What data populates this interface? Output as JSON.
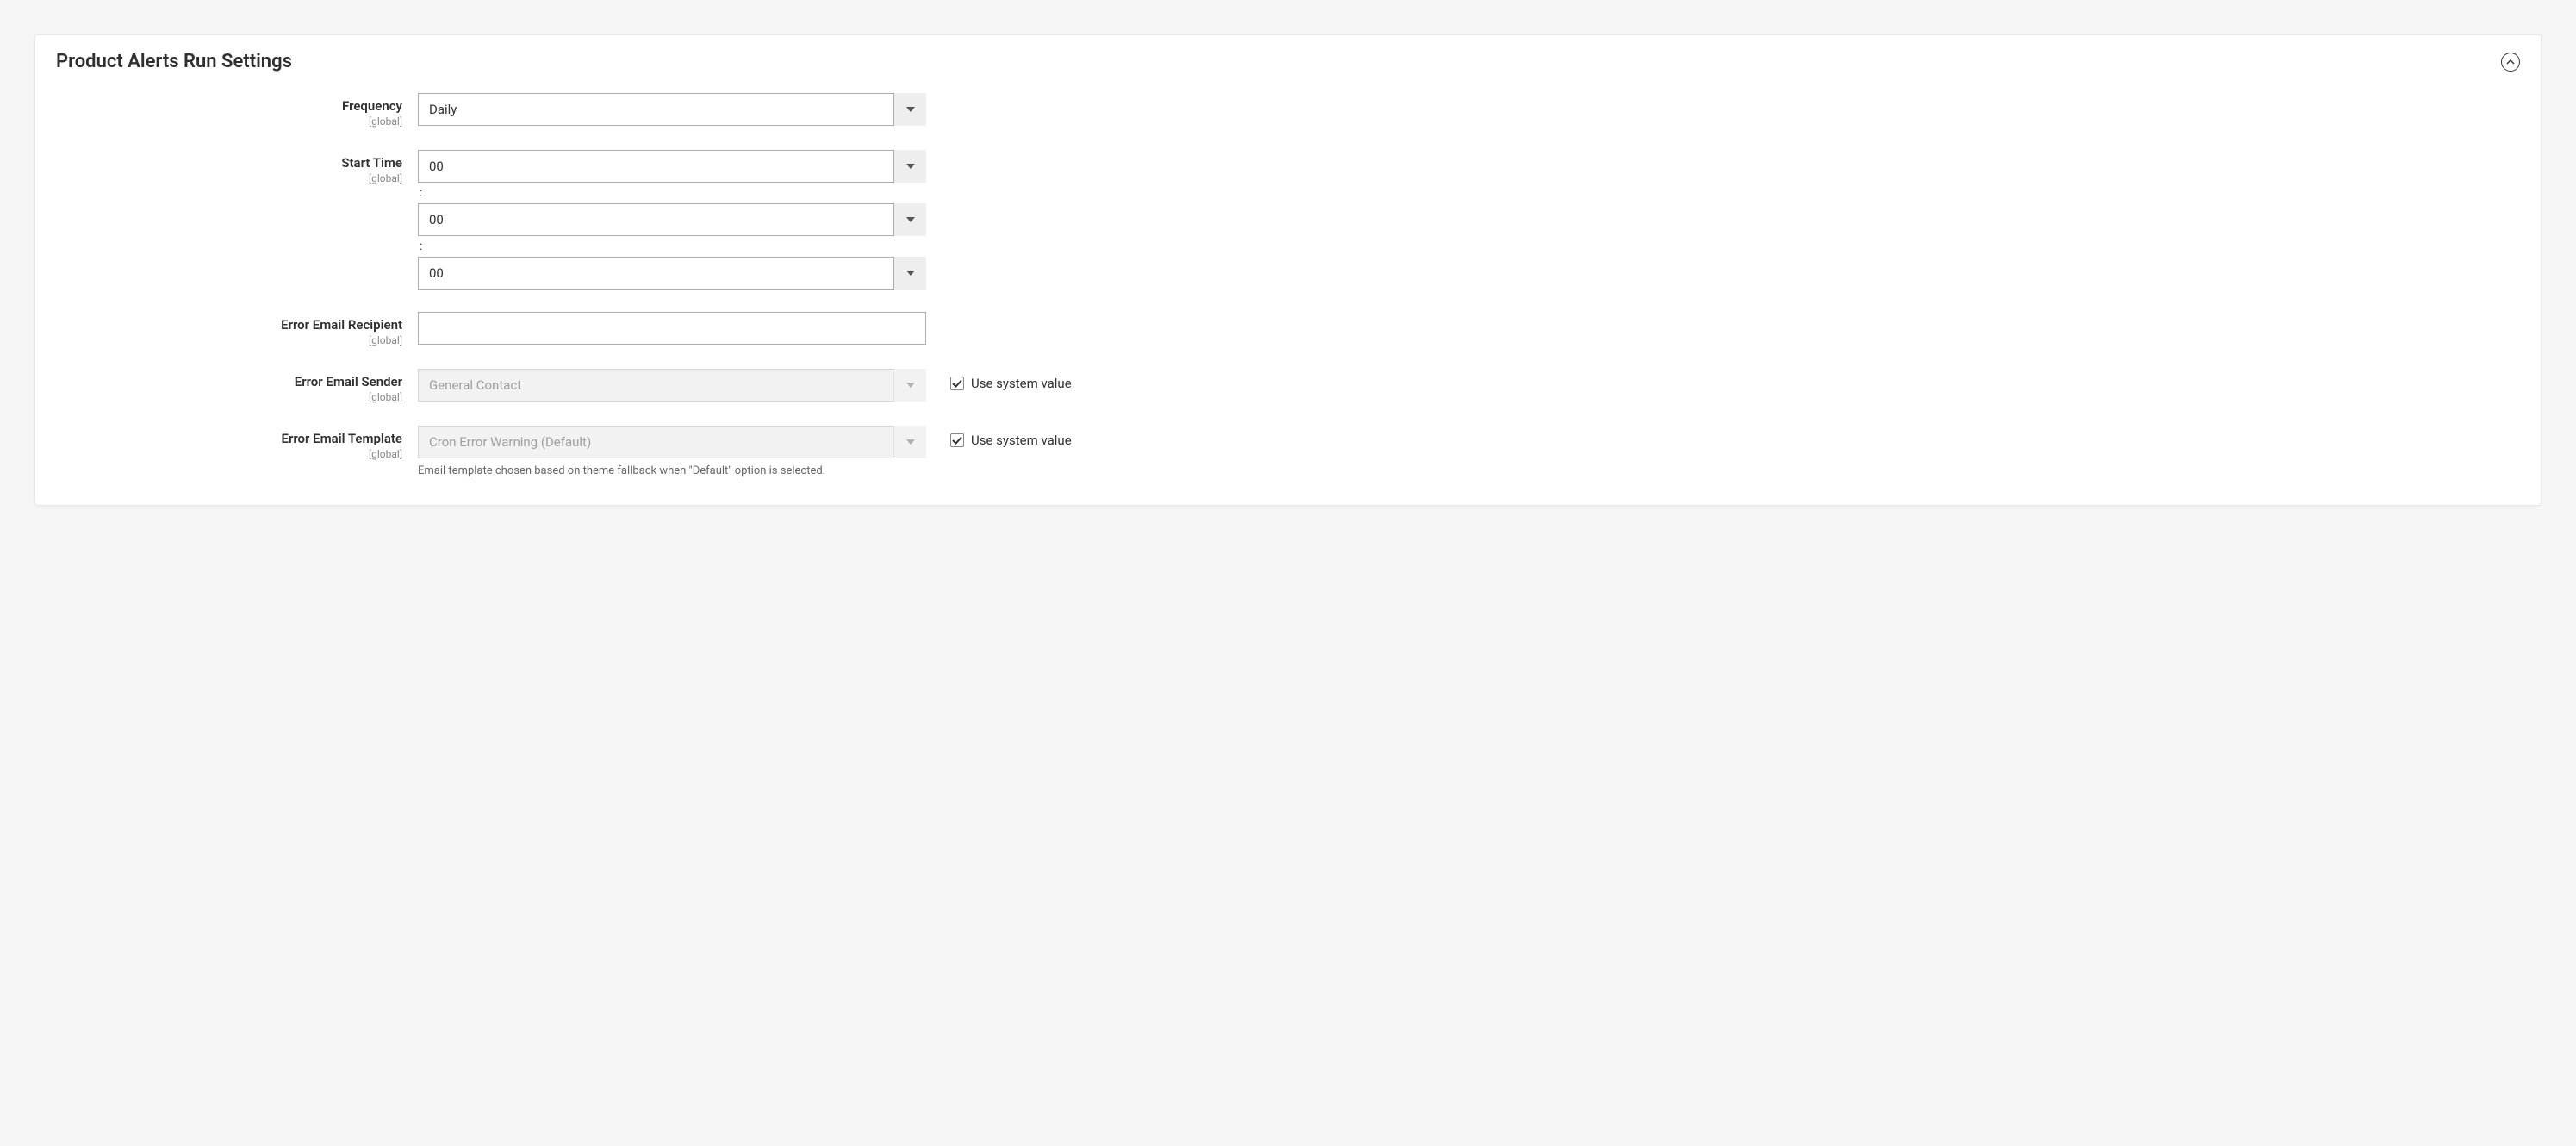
{
  "section": {
    "title": "Product Alerts Run Settings"
  },
  "scope_label": "[global]",
  "fields": {
    "frequency": {
      "label": "Frequency",
      "value": "Daily"
    },
    "start_time": {
      "label": "Start Time",
      "hour": "00",
      "minute": "00",
      "second": "00",
      "separator": ":"
    },
    "error_recipient": {
      "label": "Error Email Recipient",
      "value": ""
    },
    "error_sender": {
      "label": "Error Email Sender",
      "value": "General Contact",
      "use_system_label": "Use system value",
      "use_system_checked": true
    },
    "error_template": {
      "label": "Error Email Template",
      "value": "Cron Error Warning (Default)",
      "note": "Email template chosen based on theme fallback when \"Default\" option is selected.",
      "use_system_label": "Use system value",
      "use_system_checked": true
    }
  }
}
